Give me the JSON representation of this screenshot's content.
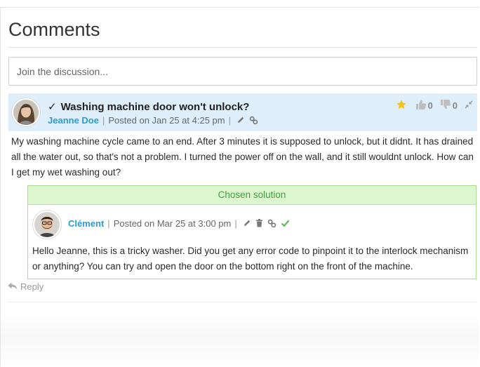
{
  "page": {
    "title": "Comments",
    "discussion_placeholder": "Join the discussion..."
  },
  "thread": {
    "title": "Washing machine door won't unlock?",
    "author": "Jeanne Doe",
    "posted": "Posted on Jan 25 at 4:25 pm",
    "upvotes": "0",
    "downvotes": "0",
    "body": "My washing machine cycle came to an end. After 3 minutes it is supposed to unlock, but it didnt. It has drained all the water out, so that's not a problem. I turned the power off on the wall, and it still wouldnt unlock. How can I get my wet washing out?"
  },
  "solution": {
    "header": "Chosen solution",
    "author": "Clément",
    "posted": "Posted on Mar 25 at 3:00 pm",
    "body": "Hello Jeanne, this is a tricky washer. Did you get any error code to pinpoint it to the interlock mechanism or anything? You can try and open the door on the bottom right on the front of the machine."
  },
  "actions": {
    "reply_label": "Reply"
  },
  "colors": {
    "author_link": "#2e9bd1",
    "thread_header_bg": "#deeefb",
    "solution_header_bg": "#dcf6d0",
    "solution_border": "#a8dc92",
    "solution_text": "#3f9f3a",
    "star": "#f5c518",
    "check_green": "#5cb85c"
  },
  "icons": {
    "thread_status": "checkmark-icon",
    "favorite": "star-icon",
    "upvote": "thumbs-up-icon",
    "downvote": "thumbs-down-icon",
    "collapse": "collapse-arrows-icon",
    "edit": "pencil-icon",
    "permalink": "link-icon",
    "delete": "trash-icon",
    "accepted": "checkmark-icon",
    "reply": "reply-arrow-icon"
  }
}
